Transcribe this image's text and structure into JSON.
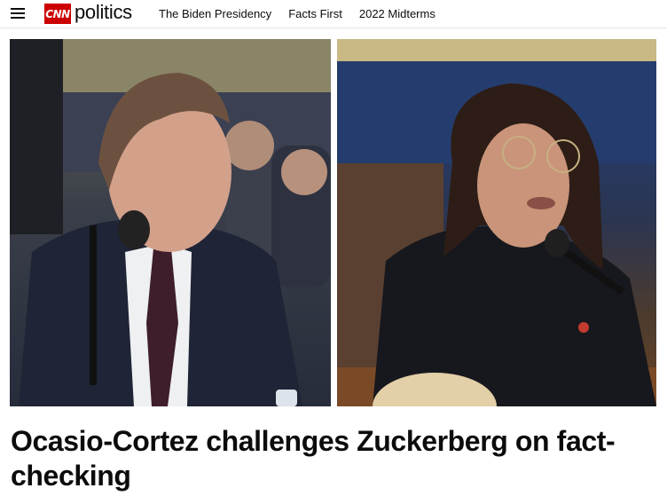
{
  "header": {
    "logo_text": "CNN",
    "section": "politics",
    "nav": [
      {
        "label": "The Biden Presidency"
      },
      {
        "label": "Facts First"
      },
      {
        "label": "2022 Midterms"
      }
    ]
  },
  "article": {
    "headline": "Ocasio-Cortez challenges Zuckerberg on fact-checking"
  },
  "colors": {
    "brand": "#cc0000",
    "text": "#0c0c0c"
  },
  "icons": [
    "menu-icon",
    "cnn-logo"
  ]
}
